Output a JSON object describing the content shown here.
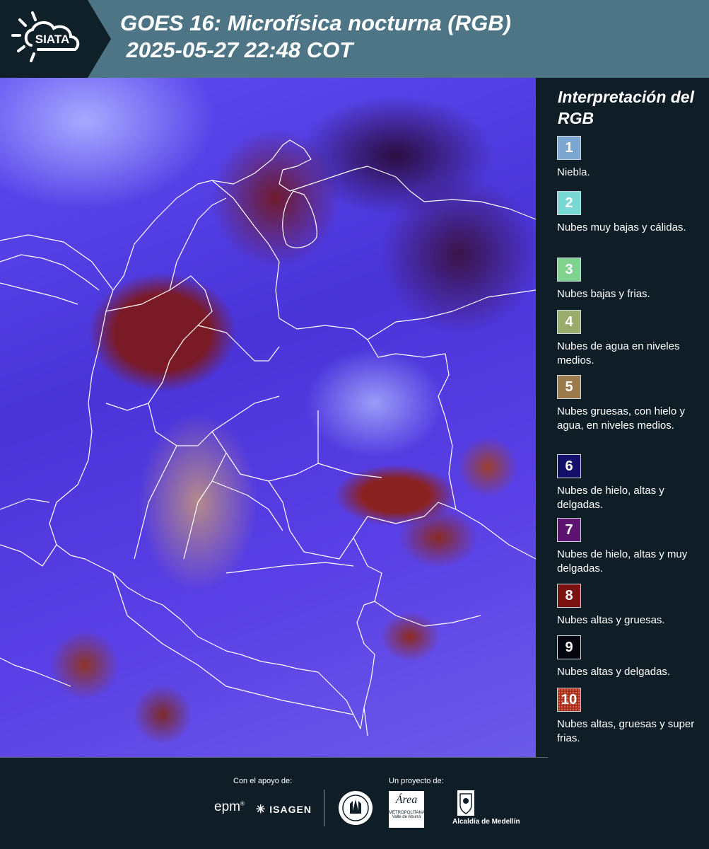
{
  "header": {
    "logo_text": "SIATA",
    "title_line1": "GOES 16: Microfísica nocturna (RGB)",
    "title_line2": " 2025-05-27 22:48 COT",
    "band_color": "#4d7585"
  },
  "legend": {
    "title": "Interpretación del RGB",
    "items": [
      {
        "number": "1",
        "color": "#7aa6cf",
        "description": "Niebla."
      },
      {
        "number": "2",
        "color": "#77d8d4",
        "description": "Nubes muy bajas y cálidas."
      },
      {
        "number": "3",
        "color": "#7fd38f",
        "description": "Nubes bajas y frias."
      },
      {
        "number": "4",
        "color": "#9aab6e",
        "description": "Nubes de agua en niveles medios."
      },
      {
        "number": "5",
        "color": "#9a7a4c",
        "description": "Nubes gruesas, con hielo y agua, en niveles medios."
      },
      {
        "number": "6",
        "color": "#14106a",
        "description": "Nubes de hielo, altas y delgadas."
      },
      {
        "number": "7",
        "color": "#5c1470",
        "description": "Nubes de hielo, altas y muy delgadas."
      },
      {
        "number": "8",
        "color": "#7a1212",
        "description": "Nubes altas y gruesas."
      },
      {
        "number": "9",
        "color": "#050510",
        "description": "Nubes altas y delgadas."
      },
      {
        "number": "10",
        "color": "#a52a1c",
        "description": "Nubes altas, gruesas y super frias."
      }
    ]
  },
  "footer": {
    "support_label": "Con el apoyo de:",
    "project_label": "Un proyecto de:",
    "sponsor_epm": "epm",
    "sponsor_isagen": "ISAGEN",
    "area_text": "Área",
    "area_sub": "METROPOLITANA",
    "area_sub2": "Valle de Aburrá",
    "alcaldia": "Alcaldía de Medellín"
  },
  "map": {
    "image_description_colors": [
      "#5f4cf2",
      "#7a1a26",
      "#a7a9ff"
    ]
  }
}
